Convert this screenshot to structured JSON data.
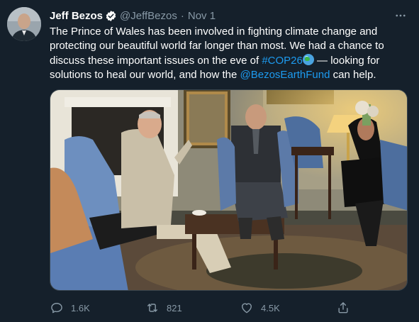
{
  "author": {
    "display_name": "Jeff Bezos",
    "handle": "@JeffBezos",
    "separator": "·",
    "timestamp": "Nov 1"
  },
  "tweet": {
    "text_before": "The Prince of Wales has been involved in fighting climate change and protecting our beautiful world far longer than most. We had a chance to discuss these important issues on the eve of ",
    "hashtag": "#COP26",
    "text_middle": " — looking for solutions to heal our world, and how the ",
    "mention": "@BezosEarthFund",
    "text_after": " can help."
  },
  "metrics": {
    "replies": "1.6K",
    "retweets": "821",
    "likes": "4.5K"
  },
  "icons": {
    "verified": "verified-badge-icon",
    "more": "more-dots-icon",
    "reply": "reply-bubble-icon",
    "retweet": "retweet-icon",
    "like": "heart-icon",
    "share": "share-icon"
  },
  "colors": {
    "background": "#15202b",
    "accent": "#1d9bf0",
    "secondary_text": "#8899a6"
  }
}
